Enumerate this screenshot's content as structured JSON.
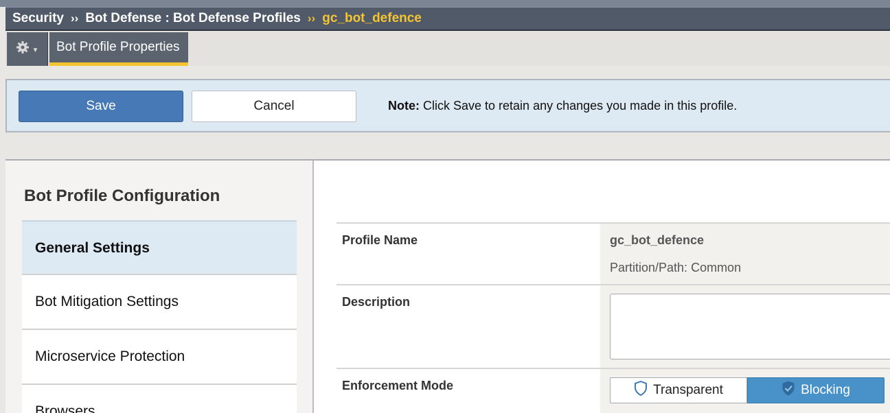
{
  "breadcrumb": {
    "items": [
      "Security",
      "Bot Defense : Bot Defense Profiles"
    ],
    "current": "gc_bot_defence",
    "separator": "››"
  },
  "tabs": {
    "gear_icon": "gear-icon",
    "active_tab": "Bot Profile Properties"
  },
  "actions": {
    "save_label": "Save",
    "cancel_label": "Cancel",
    "note_bold": "Note:",
    "note_text": " Click Save to retain any changes you made in this profile."
  },
  "sidebar": {
    "title": "Bot Profile Configuration",
    "items": [
      {
        "label": "General Settings",
        "active": true
      },
      {
        "label": "Bot Mitigation Settings"
      },
      {
        "label": "Microservice Protection"
      },
      {
        "label": "Browsers"
      }
    ]
  },
  "form": {
    "profile_name_label": "Profile Name",
    "profile_name_value": "gc_bot_defence",
    "partition_path": "Partition/Path: Common",
    "description_label": "Description",
    "description_value": "",
    "enforcement_label": "Enforcement Mode",
    "enforcement_options": [
      "Transparent",
      "Blocking"
    ],
    "enforcement_selected": "Blocking"
  },
  "colors": {
    "accent_yellow": "#f5c431",
    "save_blue": "#4679b5",
    "blocking_blue": "#4891c9",
    "active_nav_bg": "#deeaf3"
  }
}
